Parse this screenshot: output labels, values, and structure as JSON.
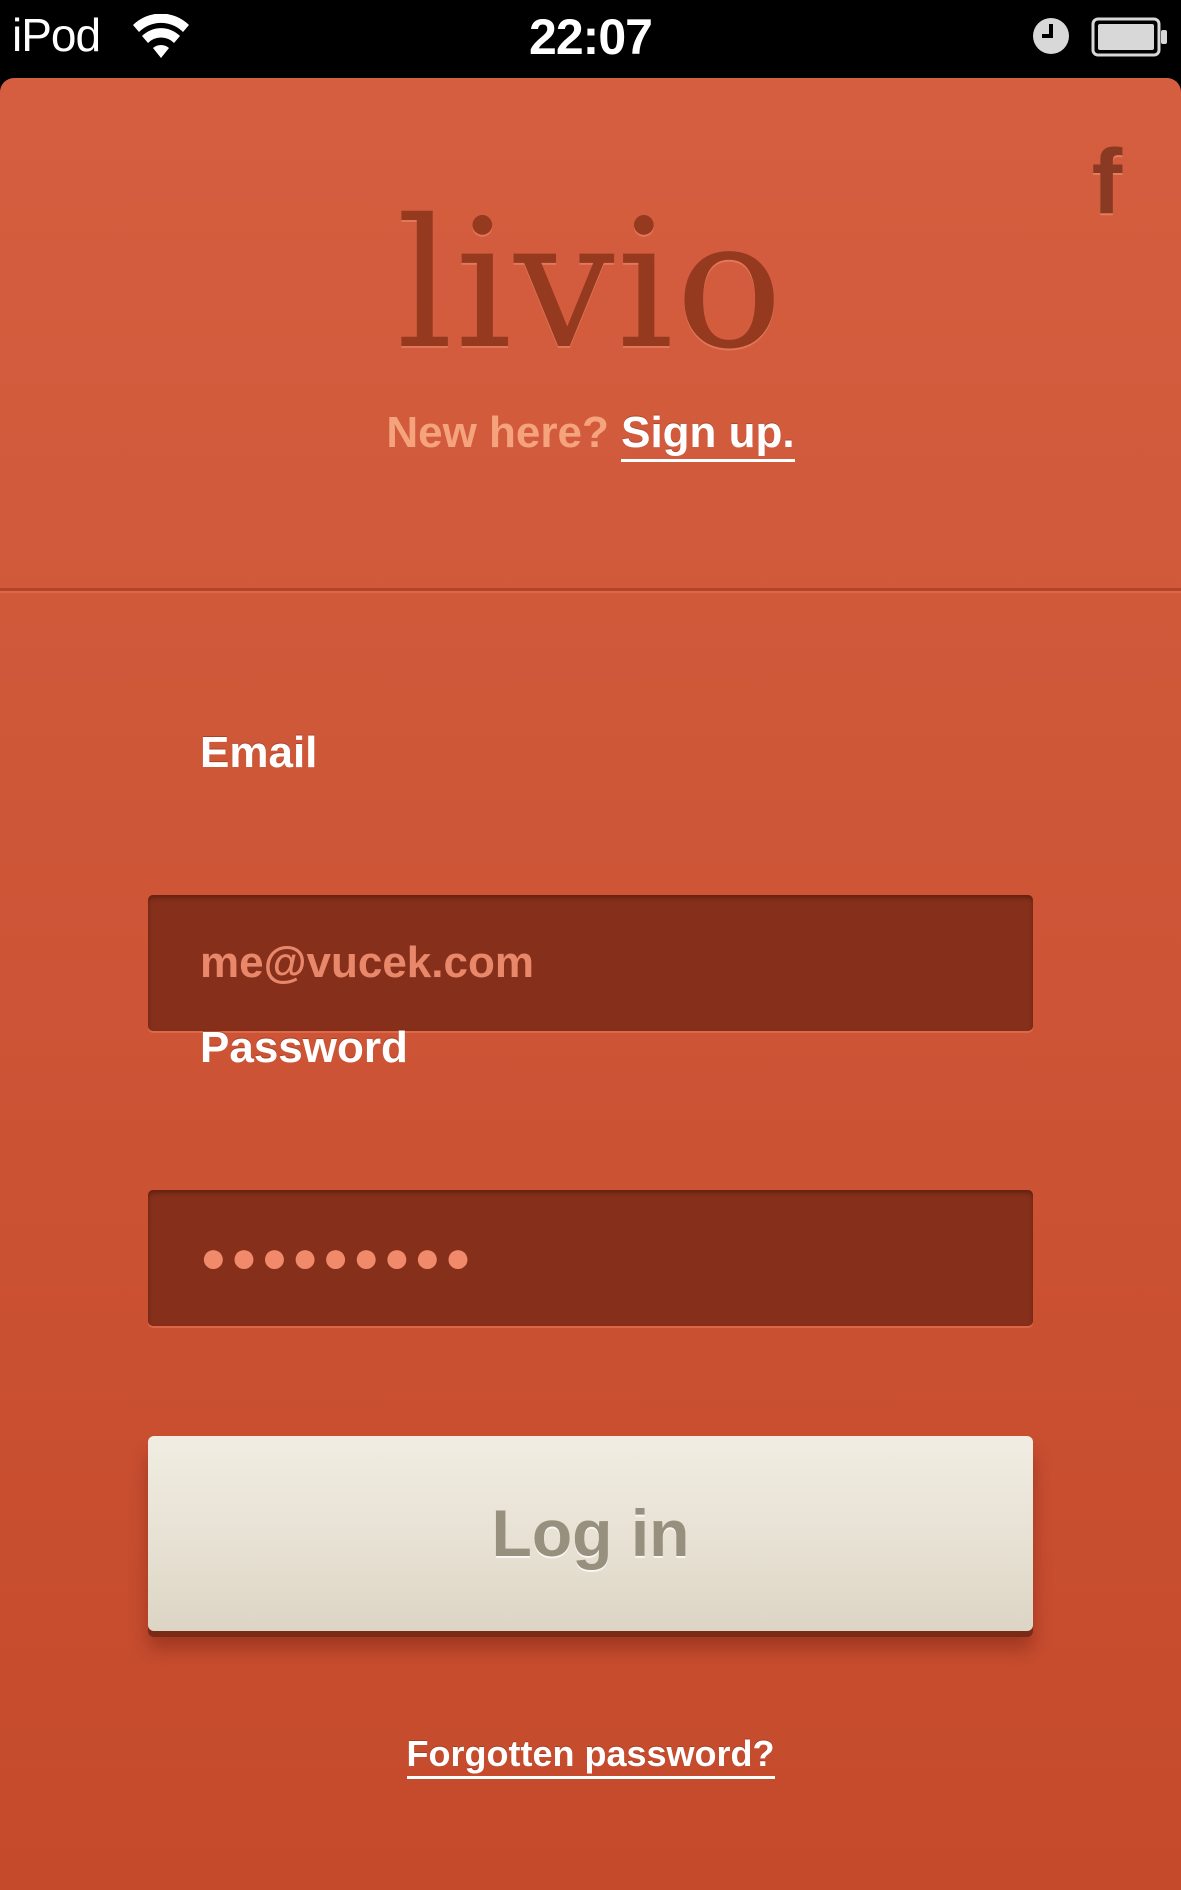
{
  "status_bar": {
    "carrier": "iPod",
    "time": "22:07",
    "icons": [
      "wifi-icon",
      "alarm-icon",
      "battery-icon"
    ]
  },
  "header": {
    "facebook_label": "f",
    "logo": "livio",
    "signup_prompt": "New here?",
    "signup_link": "Sign up."
  },
  "form": {
    "email_label": "Email",
    "email_value": "me@vucek.com",
    "password_label": "Password",
    "password_mask": "●●●●●●●●●",
    "login_label": "Log in",
    "forgot_label": "Forgotten password?"
  },
  "colors": {
    "background": "#d05a3b",
    "field": "#86301b",
    "logo": "#95391f",
    "button": "#e6e0d2",
    "button_text": "#97907f"
  }
}
